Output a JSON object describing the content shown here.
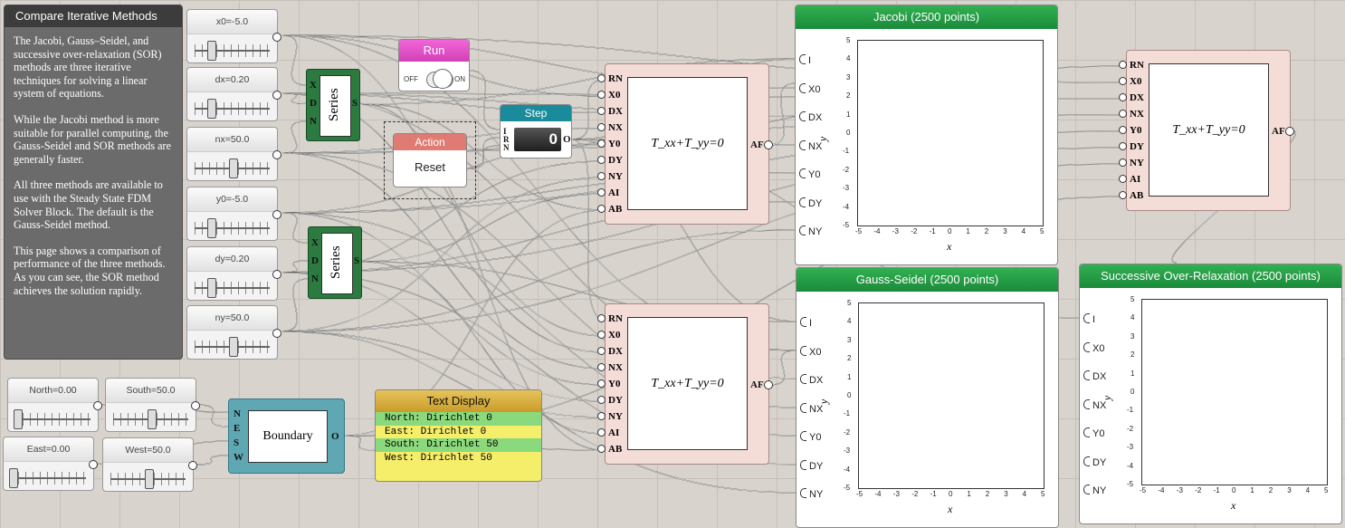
{
  "description": {
    "title": "Compare Iterative Methods",
    "paragraphs": [
      "The Jacobi, Gauss–Seidel, and successive over-relaxation (SOR) methods are three iterative techniques for solving a linear system of equations.",
      "While the Jacobi method is more suitable for parallel computing, the Gauss-Seidel and SOR methods are generally faster.",
      "All three methods are available to use with the Steady State FDM Solver Block. The default is the Gauss-Seidel method.",
      "This page shows a comparison of performance of the three methods. As you can see, the SOR method achieves the solution rapidly."
    ]
  },
  "sliders": {
    "x0": {
      "label": "x0=-5.0",
      "level": 0.2
    },
    "dx": {
      "label": "dx=0.20",
      "level": 0.2
    },
    "nx": {
      "label": "nx=50.0",
      "level": 0.5
    },
    "y0": {
      "label": "y0=-5.0",
      "level": 0.2
    },
    "dy": {
      "label": "dy=0.20",
      "level": 0.2
    },
    "ny": {
      "label": "ny=50.0",
      "level": 0.5
    },
    "north": {
      "label": "North=0.00",
      "level": 0.0
    },
    "south": {
      "label": "South=50.0",
      "level": 0.5
    },
    "east": {
      "label": "East=0.00",
      "level": 0.0
    },
    "west": {
      "label": "West=50.0",
      "level": 0.5
    }
  },
  "series_block": {
    "title": "Series",
    "ports": [
      "X",
      "D",
      "N"
    ],
    "out": "S"
  },
  "run": {
    "title": "Run",
    "off": "OFF",
    "on": "ON"
  },
  "action": {
    "title": "Action",
    "button": "Reset"
  },
  "step": {
    "title": "Step",
    "value": "0",
    "ports": [
      "I",
      "R",
      "N"
    ],
    "out": "O"
  },
  "solver": {
    "equation": "T_xx+T_yy=0",
    "ports": [
      "RN",
      "X0",
      "DX",
      "NX",
      "Y0",
      "DY",
      "NY",
      "AI",
      "AB"
    ],
    "out": "AF"
  },
  "plots": {
    "jacobi": {
      "title": "Jacobi (2500 points)"
    },
    "gauss": {
      "title": "Gauss-Seidel (2500 points)"
    },
    "sor": {
      "title": "Successive Over-Relaxation (2500 points)"
    },
    "inputs": [
      "I",
      "X0",
      "DX",
      "NX",
      "Y0",
      "DY",
      "NY"
    ],
    "xlabel": "x",
    "ylabel": "y",
    "ticks": [
      "-5",
      "-4",
      "-3",
      "-2",
      "-1",
      "0",
      "1",
      "2",
      "3",
      "4",
      "5"
    ],
    "yticks": [
      "5",
      "4",
      "3",
      "2",
      "1",
      "0",
      "-1",
      "-2",
      "-3",
      "-4",
      "-5"
    ]
  },
  "boundary": {
    "title": "Boundary",
    "ports": [
      "N",
      "E",
      "S",
      "W"
    ],
    "out": "O"
  },
  "text_display": {
    "title": "Text Display",
    "lines": [
      "North: Dirichlet 0",
      "East: Dirichlet 0",
      "South: Dirichlet 50",
      "West: Dirichlet 50"
    ]
  }
}
